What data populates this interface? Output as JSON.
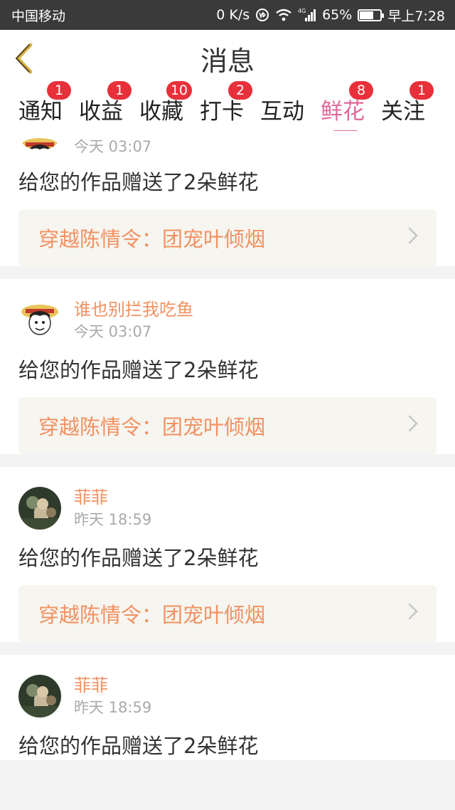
{
  "statusbar": {
    "carrier": "中国移动",
    "speed": "0 K/s",
    "network": "4G",
    "battery": "65%",
    "battery_level": 0.65,
    "time": "早上7:28"
  },
  "header": {
    "title": "消息"
  },
  "tabs": [
    {
      "label": "通知",
      "badge": "1",
      "active": false
    },
    {
      "label": "收益",
      "badge": "1",
      "active": false
    },
    {
      "label": "收藏",
      "badge": "10",
      "active": false
    },
    {
      "label": "打卡",
      "badge": "2",
      "active": false
    },
    {
      "label": "互动",
      "badge": "",
      "active": false
    },
    {
      "label": "鲜花",
      "badge": "8",
      "active": true
    },
    {
      "label": "关注",
      "badge": "1",
      "active": false
    }
  ],
  "feed": [
    {
      "user": "",
      "time": "今天 03:07",
      "message": "给您的作品赠送了2朵鲜花",
      "work": "穿越陈情令：团宠叶倾烟",
      "avatar": "onepiece-avatar"
    },
    {
      "user": "谁也别拦我吃鱼",
      "time": "今天 03:07",
      "message": "给您的作品赠送了2朵鲜花",
      "work": "穿越陈情令：团宠叶倾烟",
      "avatar": "onepiece-avatar"
    },
    {
      "user": "菲菲",
      "time": "昨天 18:59",
      "message": "给您的作品赠送了2朵鲜花",
      "work": "穿越陈情令：团宠叶倾烟",
      "avatar": "photo-avatar"
    },
    {
      "user": "菲菲",
      "time": "昨天 18:59",
      "message": "给您的作品赠送了2朵鲜花",
      "work": "",
      "avatar": "photo-avatar"
    }
  ],
  "colors": {
    "accent": "#e0689a",
    "badge": "#e8303a",
    "username": "#f29162"
  }
}
